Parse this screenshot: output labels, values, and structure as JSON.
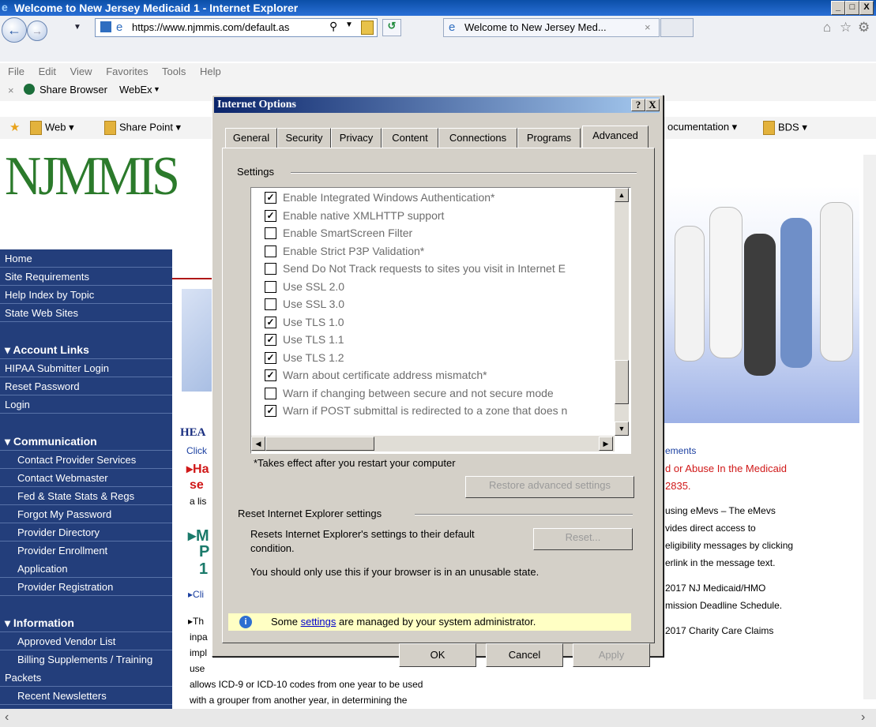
{
  "window": {
    "title": "Welcome to New Jersey Medicaid 1 - Internet Explorer"
  },
  "browser": {
    "url": "https://www.njmmis.com/default.as",
    "tab_title": "Welcome to New Jersey Med...",
    "menu": [
      "File",
      "Edit",
      "View",
      "Favorites",
      "Tools",
      "Help"
    ],
    "command_items": [
      "Share Browser",
      "WebEx"
    ],
    "favorites": [
      "Web",
      "Share Point",
      "ocumentation",
      "BDS"
    ]
  },
  "page": {
    "logo": "NJMMIS",
    "nav_top": [
      "Home",
      "Site Requirements",
      "Help Index by Topic",
      "State Web Sites"
    ],
    "account_header": "Account Links",
    "account_items": [
      "HIPAA Submitter Login",
      "Reset Password",
      "Login"
    ],
    "communication_header": "Communication",
    "communication_items": [
      "Contact Provider Services",
      "Contact Webmaster",
      "Fed & State Stats & Regs",
      "Forgot My Password",
      "Provider Directory",
      "Provider Enrollment",
      "Application",
      "Provider Registration"
    ],
    "information_header": "Information",
    "information_items": [
      "Approved Vendor List",
      "Billing Supplements / Training",
      "Packets",
      "Recent Newsletters"
    ],
    "heading_fragment": "HEA",
    "click_fragment": "Click",
    "ha_fragment": "Ha",
    "se_fragment": "se",
    "alist_fragment": "a lis",
    "m_fragment": "M",
    "p_fragment": "P",
    "one_fragment": "1",
    "cli_fragment": "Cli",
    "th_fragment": "Th",
    "inpa_fragment": "inpa",
    "impl_fragment": "impl",
    "use_fragment": "use",
    "bottom_line1": "allows ICD-9 or ICD-10 codes from one year to be used",
    "bottom_line2": "with a grouper from another year, in determining the",
    "right_texts": {
      "ements": "ements",
      "abuse": "d or Abuse In the Medicaid",
      "phone": "2835.",
      "emevs1": "using eMevs – The eMevs",
      "emevs2": "vides direct access to",
      "emevs3": "eligibility messages by clicking",
      "emevs4": "erlink in the message text.",
      "nj1": "2017 NJ Medicaid/HMO",
      "nj2": "mission Deadline Schedule.",
      "charity": "2017 Charity Care Claims"
    }
  },
  "dialog": {
    "title": "Internet Options",
    "help": "?",
    "close": "X",
    "tabs": [
      "General",
      "Security",
      "Privacy",
      "Content",
      "Connections",
      "Programs",
      "Advanced"
    ],
    "settings_label": "Settings",
    "items": [
      {
        "label": "Enable Integrated Windows Authentication*",
        "checked": true
      },
      {
        "label": "Enable native XMLHTTP support",
        "checked": true
      },
      {
        "label": "Enable SmartScreen Filter",
        "checked": false
      },
      {
        "label": "Enable Strict P3P Validation*",
        "checked": false
      },
      {
        "label": "Send Do Not Track requests to sites you visit in Internet E",
        "checked": false
      },
      {
        "label": "Use SSL 2.0",
        "checked": false
      },
      {
        "label": "Use SSL 3.0",
        "checked": false
      },
      {
        "label": "Use TLS 1.0",
        "checked": true
      },
      {
        "label": "Use TLS 1.1",
        "checked": true
      },
      {
        "label": "Use TLS 1.2",
        "checked": true
      },
      {
        "label": "Warn about certificate address mismatch*",
        "checked": true
      },
      {
        "label": "Warn if changing between secure and not secure mode",
        "checked": false
      },
      {
        "label": "Warn if POST submittal is redirected to a zone that does n",
        "checked": true
      }
    ],
    "restart_note": "*Takes effect after you restart your computer",
    "restore_button": "Restore advanced settings",
    "reset_group": "Reset Internet Explorer settings",
    "reset_desc1": "Resets Internet Explorer's settings to their default",
    "reset_desc2": "condition.",
    "reset_button": "Reset...",
    "reset_warning": "You should only use this if your browser is in an unusable state.",
    "info_pre": "Some",
    "info_link": "settings",
    "info_post": "are managed by your system administrator.",
    "ok": "OK",
    "cancel": "Cancel",
    "apply": "Apply"
  }
}
